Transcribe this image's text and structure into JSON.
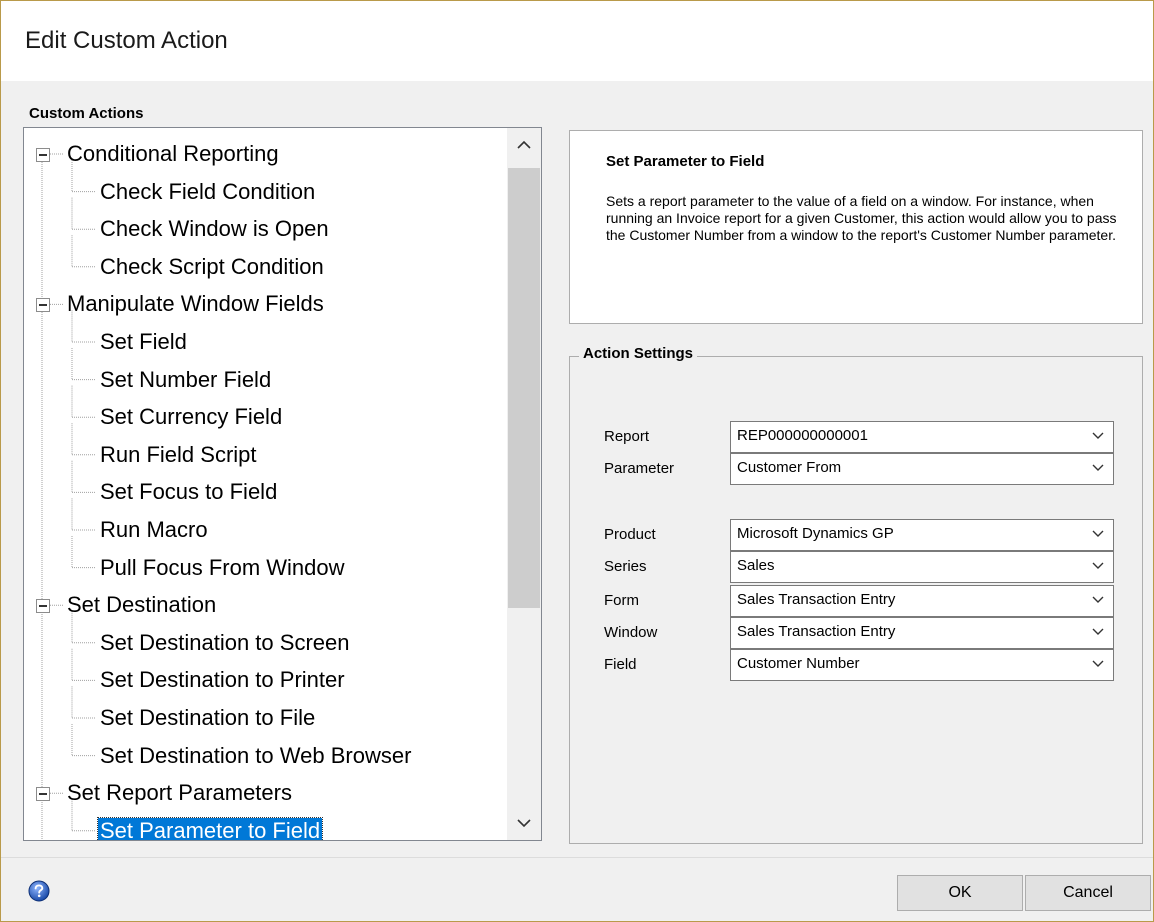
{
  "window": {
    "title": "Edit Custom Action"
  },
  "tree": {
    "header": "Custom Actions",
    "nodes": [
      {
        "label": "Conditional Reporting",
        "level": 0
      },
      {
        "label": "Check Field Condition",
        "level": 1
      },
      {
        "label": "Check Window is Open",
        "level": 1
      },
      {
        "label": "Check Script Condition",
        "level": 1
      },
      {
        "label": "Manipulate Window Fields",
        "level": 0
      },
      {
        "label": "Set Field",
        "level": 1
      },
      {
        "label": "Set Number Field",
        "level": 1
      },
      {
        "label": "Set Currency Field",
        "level": 1
      },
      {
        "label": "Run Field Script",
        "level": 1
      },
      {
        "label": "Set Focus to Field",
        "level": 1
      },
      {
        "label": "Run Macro",
        "level": 1
      },
      {
        "label": "Pull Focus From Window",
        "level": 1
      },
      {
        "label": "Set Destination",
        "level": 0
      },
      {
        "label": "Set Destination to Screen",
        "level": 1
      },
      {
        "label": "Set Destination to Printer",
        "level": 1
      },
      {
        "label": "Set Destination to File",
        "level": 1
      },
      {
        "label": "Set Destination to Web Browser",
        "level": 1
      },
      {
        "label": "Set Report Parameters",
        "level": 0
      },
      {
        "label": "Set Parameter to Field",
        "level": 1,
        "selected": true
      }
    ]
  },
  "description": {
    "title": "Set Parameter to Field",
    "body": "Sets a report parameter to the value of a field on a window. For instance, when running an Invoice report for a given Customer, this action would allow you to pass the Customer Number from a window to the report's Customer Number parameter."
  },
  "settings": {
    "title": "Action Settings",
    "report": {
      "label": "Report",
      "value": "REP000000000001"
    },
    "parameter": {
      "label": "Parameter",
      "value": "Customer From"
    },
    "product": {
      "label": "Product",
      "value": "Microsoft Dynamics GP"
    },
    "series": {
      "label": "Series",
      "value": "Sales"
    },
    "form": {
      "label": "Form",
      "value": "Sales Transaction Entry"
    },
    "window": {
      "label": "Window",
      "value": "Sales Transaction Entry"
    },
    "field": {
      "label": "Field",
      "value": "Customer Number"
    }
  },
  "buttons": {
    "ok": "OK",
    "cancel": "Cancel"
  },
  "icons": {
    "help": "help-icon",
    "expander": "collapse-box-icon",
    "dropdown": "chevron-down-icon"
  },
  "colors": {
    "selection": "#0078d7",
    "border_accent": "#b99a4a"
  }
}
